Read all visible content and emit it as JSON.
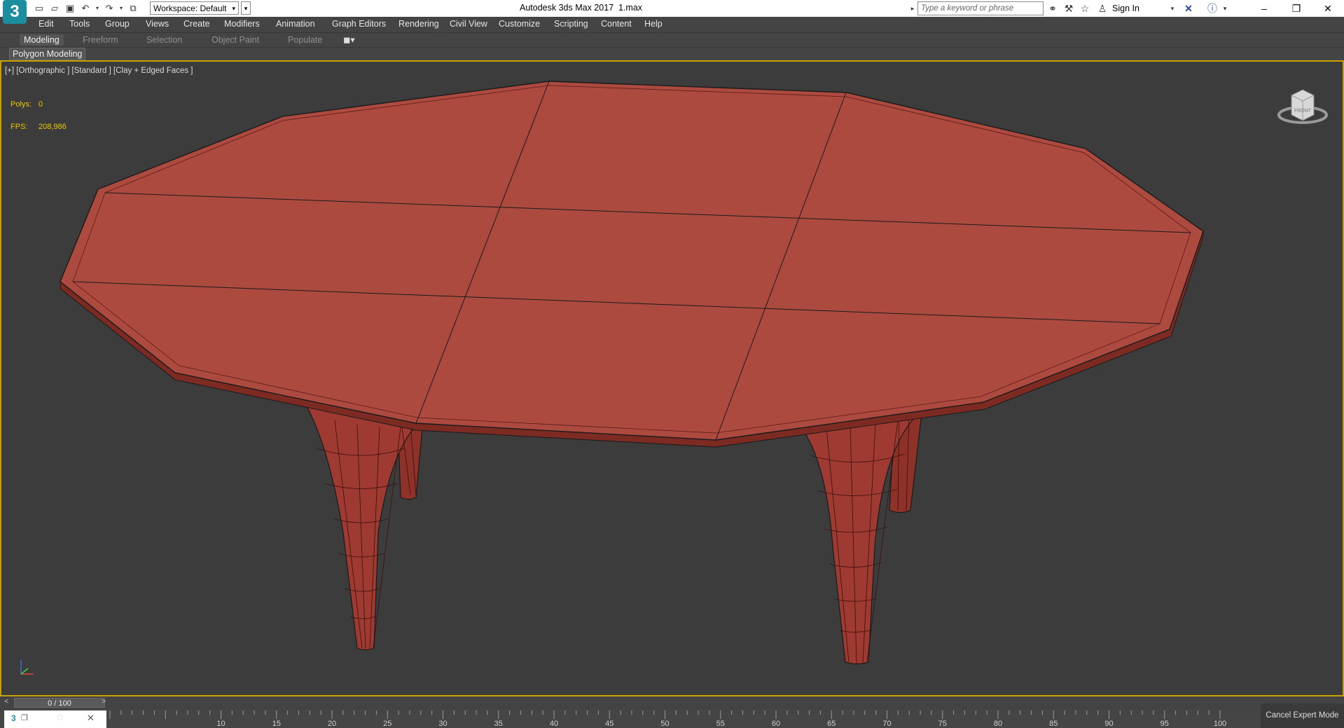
{
  "app": {
    "title": "Autodesk 3ds Max 2017",
    "file": "1.max",
    "logo": "3",
    "workspace_label": "Workspace: Default",
    "search_placeholder": "Type a keyword or phrase",
    "sign_in": "Sign In"
  },
  "menu": [
    "Edit",
    "Tools",
    "Group",
    "Views",
    "Create",
    "Modifiers",
    "Animation",
    "Graph Editors",
    "Rendering",
    "Civil View",
    "Customize",
    "Scripting",
    "Content",
    "Help"
  ],
  "ribbon": {
    "tabs": [
      "Modeling",
      "Freeform",
      "Selection",
      "Object Paint",
      "Populate"
    ],
    "active_tab": "Modeling",
    "panel": "Polygon Modeling"
  },
  "viewport": {
    "label": "[+] [Orthographic ] [Standard ] [Clay + Edged Faces ]",
    "polys_label": "Polys:",
    "polys_value": "0",
    "fps_label": "FPS:",
    "fps_value": "208,986",
    "viewcube_label": "FRONT",
    "border_color": "#c4a000",
    "object_color": "#ad4a40"
  },
  "timeline": {
    "frame": "0 / 100",
    "ticks": [
      "10",
      "15",
      "20",
      "25",
      "30",
      "35",
      "40",
      "45",
      "50",
      "55",
      "60",
      "65",
      "70",
      "75",
      "80",
      "85",
      "90",
      "95",
      "100"
    ]
  },
  "status": {
    "cancel_expert": "Cancel Expert Mode"
  }
}
